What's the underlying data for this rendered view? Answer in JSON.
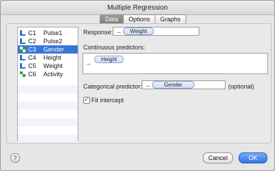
{
  "window": {
    "title": "Multiple Regression"
  },
  "tabs": [
    {
      "label": "Data",
      "active": true
    },
    {
      "label": "Options",
      "active": false
    },
    {
      "label": "Graphs",
      "active": false
    }
  ],
  "variables": [
    {
      "id": "C1",
      "name": "Pulse1",
      "type": "continuous",
      "selected": false
    },
    {
      "id": "C2",
      "name": "Pulse2",
      "type": "continuous",
      "selected": false
    },
    {
      "id": "C3",
      "name": "Gender",
      "type": "categorical",
      "selected": true
    },
    {
      "id": "C4",
      "name": "Height",
      "type": "continuous",
      "selected": false
    },
    {
      "id": "C5",
      "name": "Weight",
      "type": "continuous",
      "selected": false
    },
    {
      "id": "C6",
      "name": "Activity",
      "type": "categorical",
      "selected": false
    }
  ],
  "form": {
    "response_label": "Response:",
    "response_value": "Weight",
    "continuous_label": "Continuous predictors:",
    "continuous_values": [
      "Height"
    ],
    "categorical_label": "Categorical predictor:",
    "categorical_value": "Gender",
    "optional_label": "(optional)",
    "fit_intercept_label": "Fit intercept",
    "fit_intercept_checked": true
  },
  "arrow_glyph": "→",
  "buttons": {
    "help": "?",
    "cancel": "Cancel",
    "ok": "OK"
  },
  "colors": {
    "selection": "#3875d7",
    "categorical_icon": [
      "#2f9a3a",
      "#2f6bd0"
    ]
  }
}
